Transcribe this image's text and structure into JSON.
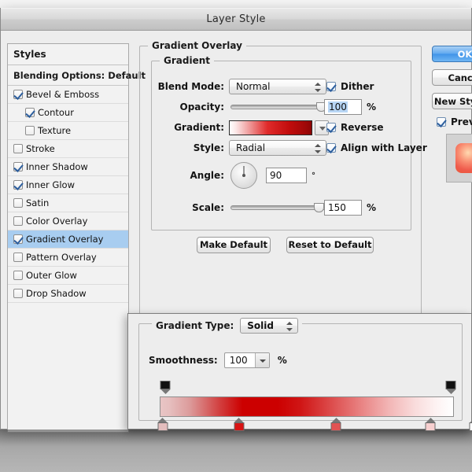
{
  "window": {
    "title": "Layer Style"
  },
  "styles_panel": {
    "header": "Styles",
    "blending_options": "Blending Options: Default",
    "items": [
      {
        "label": "Bevel & Emboss",
        "checked": true,
        "indent": false,
        "selected": false
      },
      {
        "label": "Contour",
        "checked": true,
        "indent": true,
        "selected": false
      },
      {
        "label": "Texture",
        "checked": false,
        "indent": true,
        "selected": false
      },
      {
        "label": "Stroke",
        "checked": false,
        "indent": false,
        "selected": false
      },
      {
        "label": "Inner Shadow",
        "checked": true,
        "indent": false,
        "selected": false
      },
      {
        "label": "Inner Glow",
        "checked": true,
        "indent": false,
        "selected": false
      },
      {
        "label": "Satin",
        "checked": false,
        "indent": false,
        "selected": false
      },
      {
        "label": "Color Overlay",
        "checked": false,
        "indent": false,
        "selected": false
      },
      {
        "label": "Gradient Overlay",
        "checked": true,
        "indent": false,
        "selected": true
      },
      {
        "label": "Pattern Overlay",
        "checked": false,
        "indent": false,
        "selected": false
      },
      {
        "label": "Outer Glow",
        "checked": false,
        "indent": false,
        "selected": false
      },
      {
        "label": "Drop Shadow",
        "checked": false,
        "indent": false,
        "selected": false
      }
    ]
  },
  "overlay": {
    "legend": "Gradient Overlay",
    "gradient_legend": "Gradient",
    "blend_mode": {
      "label": "Blend Mode:",
      "value": "Normal"
    },
    "opacity": {
      "label": "Opacity:",
      "value": "100",
      "unit": "%"
    },
    "gradient": {
      "label": "Gradient:"
    },
    "style": {
      "label": "Style:",
      "value": "Radial"
    },
    "angle": {
      "label": "Angle:",
      "value": "90",
      "unit": "°"
    },
    "scale": {
      "label": "Scale:",
      "value": "150",
      "unit": "%"
    },
    "dither": {
      "label": "Dither",
      "checked": true
    },
    "reverse": {
      "label": "Reverse",
      "checked": true
    },
    "align_with_layer": {
      "label": "Align with Layer",
      "checked": true
    },
    "make_default": "Make Default",
    "reset_to_default": "Reset to Default"
  },
  "buttons": {
    "ok": "OK",
    "cancel": "Cancel",
    "new_style": "New Style...",
    "preview": {
      "label": "Preview",
      "checked": true
    }
  },
  "gradient_editor": {
    "gradient_type": {
      "label": "Gradient Type:",
      "value": "Solid"
    },
    "smoothness": {
      "label": "Smoothness:",
      "value": "100",
      "unit": "%"
    },
    "opacity_stops": [
      {
        "position": 0,
        "color": "#111111"
      },
      {
        "position": 100,
        "color": "#111111"
      }
    ],
    "color_stops": [
      {
        "position": 1,
        "color": "#e3bdbd"
      },
      {
        "position": 27,
        "color": "#d81414"
      },
      {
        "position": 60,
        "color": "#e15353"
      },
      {
        "position": 92,
        "color": "#f7cfcf"
      },
      {
        "position": 107,
        "color": "#ffffff"
      }
    ]
  },
  "colors": {
    "selection_blue": "#a8cdf0",
    "accent_red": "#cc0000",
    "field_selection": "#b8d6f5"
  }
}
